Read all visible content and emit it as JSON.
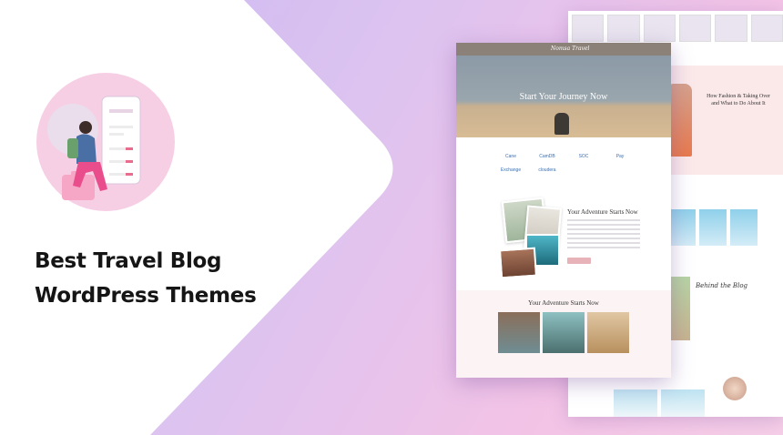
{
  "banner": {
    "title_line1": "Best Travel Blog",
    "title_line2": "WordPress Themes"
  },
  "mockup_front": {
    "hero_title": "Start Your Journey Now",
    "section_title": "Your Adventure Starts Now",
    "section2_title": "Your Adventure Starts Now",
    "logo_text": "Nomsa Travel",
    "partner_logos": [
      "Cane",
      "CamDB",
      "SOC",
      "Pay",
      "Exchange",
      "cloudera",
      "",
      ""
    ]
  },
  "mockup_back": {
    "hero_text": "How Fashion & Taking Over and What to Do About It",
    "behind_title": "Behind the Blog"
  },
  "colors": {
    "background_start": "#c9b6f2",
    "background_end": "#f6cfe8",
    "panel": "#ffffff",
    "accent_pink": "#e7b3b8"
  }
}
